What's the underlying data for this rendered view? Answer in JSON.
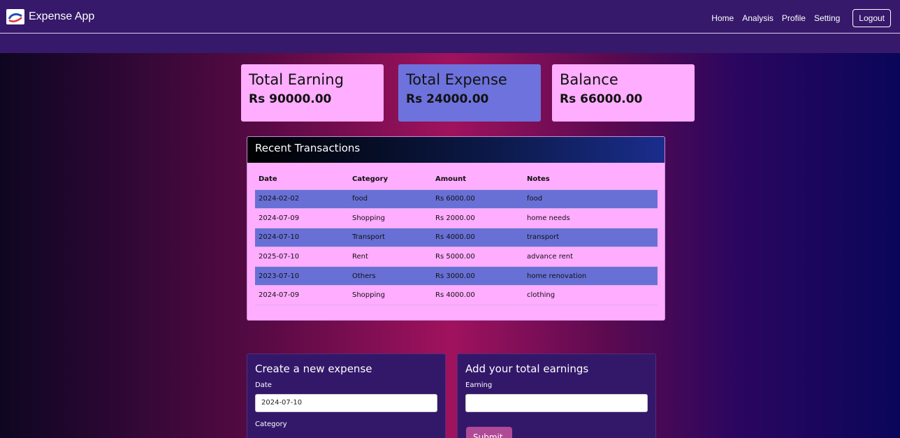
{
  "navbar": {
    "brand": "Expense App",
    "links": [
      "Home",
      "Analysis",
      "Profile",
      "Setting"
    ],
    "logout": "Logout"
  },
  "summary": {
    "earning": {
      "title": "Total Earning",
      "value": "Rs 90000.00",
      "color": "#ffadff"
    },
    "expense": {
      "title": "Total Expense",
      "value": "Rs 24000.00",
      "color": "#6d72dc"
    },
    "balance": {
      "title": "Balance",
      "value": "Rs 66000.00",
      "color": "#ffadff"
    }
  },
  "transactions": {
    "title": "Recent Transactions",
    "headers": [
      "Date",
      "Category",
      "Amount",
      "Notes"
    ],
    "rows": [
      [
        "2024-02-02",
        "food",
        "Rs 6000.00",
        "food"
      ],
      [
        "2024-07-09",
        "Shopping",
        "Rs 2000.00",
        "home needs"
      ],
      [
        "2024-07-10",
        "Transport",
        "Rs 4000.00",
        "transport"
      ],
      [
        "2025-07-10",
        "Rent",
        "Rs 5000.00",
        "advance rent"
      ],
      [
        "2023-07-10",
        "Others",
        "Rs 3000.00",
        "home renovation"
      ],
      [
        "2024-07-09",
        "Shopping",
        "Rs 4000.00",
        "clothing"
      ]
    ]
  },
  "expense_form": {
    "title": "Create a new expense",
    "date_label": "Date",
    "date_value": "2024-07-10",
    "category_label": "Category"
  },
  "earning_form": {
    "title": "Add your total earnings",
    "earning_label": "Earning",
    "earning_value": "",
    "submit": "Submit"
  },
  "colors": {
    "navbar": "#36196a",
    "row_shade": "#6870d6",
    "panel_pink": "#ffadff",
    "submit": "#b04a96"
  }
}
